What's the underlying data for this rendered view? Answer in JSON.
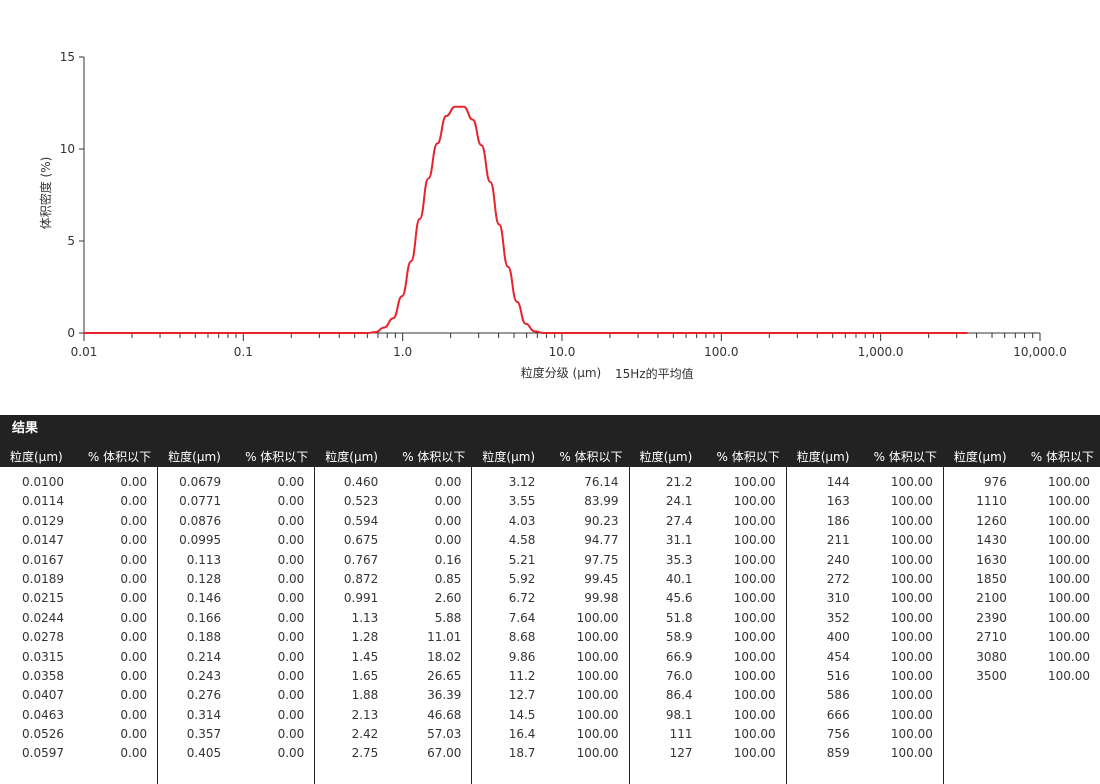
{
  "chart_data": {
    "type": "line",
    "xscale": "log",
    "xlim": [
      0.01,
      10000
    ],
    "ylim": [
      0,
      15
    ],
    "yticks": [
      0,
      5,
      10,
      15
    ],
    "xtick_labels": [
      "0.01",
      "0.1",
      "1.0",
      "10.0",
      "100.0",
      "1,000.0",
      "10,000.0"
    ],
    "xticks": [
      0.01,
      0.1,
      1,
      10,
      100,
      1000,
      10000
    ],
    "ylabel": "体积密度 (%)",
    "xlabel": "粒度分级 (μm)",
    "legend": "15Hz的平均值",
    "line_color": "#e8232d",
    "x": [
      0.01,
      0.1,
      0.6,
      0.675,
      0.767,
      0.872,
      0.991,
      1.13,
      1.28,
      1.45,
      1.65,
      1.88,
      2.13,
      2.42,
      2.75,
      3.12,
      3.55,
      4.03,
      4.58,
      5.21,
      5.92,
      6.72,
      7.64,
      10,
      100,
      1000,
      3500
    ],
    "y": [
      0,
      0,
      0,
      0.05,
      0.3,
      0.8,
      2.0,
      3.9,
      6.2,
      8.4,
      10.3,
      11.8,
      12.3,
      12.3,
      11.6,
      10.2,
      8.2,
      5.9,
      3.6,
      1.7,
      0.5,
      0.1,
      0,
      0,
      0,
      0,
      0
    ]
  },
  "results": {
    "title": "结果",
    "col_size_header": "粒度(μm)",
    "col_pct_header": "% 体积以下",
    "groups": [
      {
        "sizes": [
          "0.0100",
          "0.0114",
          "0.0129",
          "0.0147",
          "0.0167",
          "0.0189",
          "0.0215",
          "0.0244",
          "0.0278",
          "0.0315",
          "0.0358",
          "0.0407",
          "0.0463",
          "0.0526",
          "0.0597"
        ],
        "pcts": [
          "0.00",
          "0.00",
          "0.00",
          "0.00",
          "0.00",
          "0.00",
          "0.00",
          "0.00",
          "0.00",
          "0.00",
          "0.00",
          "0.00",
          "0.00",
          "0.00",
          "0.00"
        ]
      },
      {
        "sizes": [
          "0.0679",
          "0.0771",
          "0.0876",
          "0.0995",
          "0.113",
          "0.128",
          "0.146",
          "0.166",
          "0.188",
          "0.214",
          "0.243",
          "0.276",
          "0.314",
          "0.357",
          "0.405"
        ],
        "pcts": [
          "0.00",
          "0.00",
          "0.00",
          "0.00",
          "0.00",
          "0.00",
          "0.00",
          "0.00",
          "0.00",
          "0.00",
          "0.00",
          "0.00",
          "0.00",
          "0.00",
          "0.00"
        ]
      },
      {
        "sizes": [
          "0.460",
          "0.523",
          "0.594",
          "0.675",
          "0.767",
          "0.872",
          "0.991",
          "1.13",
          "1.28",
          "1.45",
          "1.65",
          "1.88",
          "2.13",
          "2.42",
          "2.75"
        ],
        "pcts": [
          "0.00",
          "0.00",
          "0.00",
          "0.00",
          "0.16",
          "0.85",
          "2.60",
          "5.88",
          "11.01",
          "18.02",
          "26.65",
          "36.39",
          "46.68",
          "57.03",
          "67.00"
        ]
      },
      {
        "sizes": [
          "3.12",
          "3.55",
          "4.03",
          "4.58",
          "5.21",
          "5.92",
          "6.72",
          "7.64",
          "8.68",
          "9.86",
          "11.2",
          "12.7",
          "14.5",
          "16.4",
          "18.7"
        ],
        "pcts": [
          "76.14",
          "83.99",
          "90.23",
          "94.77",
          "97.75",
          "99.45",
          "99.98",
          "100.00",
          "100.00",
          "100.00",
          "100.00",
          "100.00",
          "100.00",
          "100.00",
          "100.00"
        ]
      },
      {
        "sizes": [
          "21.2",
          "24.1",
          "27.4",
          "31.1",
          "35.3",
          "40.1",
          "45.6",
          "51.8",
          "58.9",
          "66.9",
          "76.0",
          "86.4",
          "98.1",
          "111",
          "127"
        ],
        "pcts": [
          "100.00",
          "100.00",
          "100.00",
          "100.00",
          "100.00",
          "100.00",
          "100.00",
          "100.00",
          "100.00",
          "100.00",
          "100.00",
          "100.00",
          "100.00",
          "100.00",
          "100.00"
        ]
      },
      {
        "sizes": [
          "144",
          "163",
          "186",
          "211",
          "240",
          "272",
          "310",
          "352",
          "400",
          "454",
          "516",
          "586",
          "666",
          "756",
          "859"
        ],
        "pcts": [
          "100.00",
          "100.00",
          "100.00",
          "100.00",
          "100.00",
          "100.00",
          "100.00",
          "100.00",
          "100.00",
          "100.00",
          "100.00",
          "100.00",
          "100.00",
          "100.00",
          "100.00"
        ]
      },
      {
        "sizes": [
          "976",
          "1110",
          "1260",
          "1430",
          "1630",
          "1850",
          "2100",
          "2390",
          "2710",
          "3080",
          "3500"
        ],
        "pcts": [
          "100.00",
          "100.00",
          "100.00",
          "100.00",
          "100.00",
          "100.00",
          "100.00",
          "100.00",
          "100.00",
          "100.00",
          "100.00"
        ]
      }
    ]
  }
}
